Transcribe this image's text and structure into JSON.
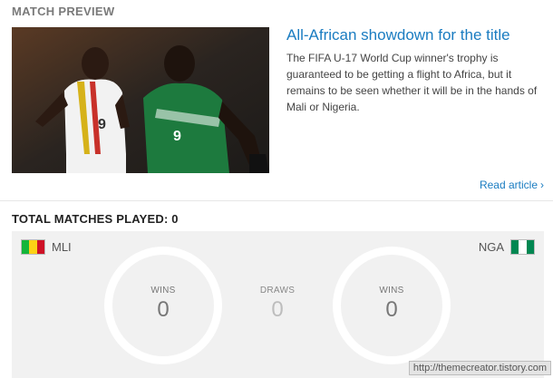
{
  "section": {
    "title": "MATCH PREVIEW"
  },
  "article": {
    "title": "All-African showdown for the title",
    "summary": "The FIFA U-17 World Cup winner's trophy is guaranteed to be getting a flight to Africa, but it remains to be seen whether it will be in the hands of Mali or Nigeria.",
    "read_more": "Read article",
    "read_more_icon": "chevron-right-icon",
    "photo_desc_icon": "match-photo"
  },
  "stats": {
    "total_label": "TOTAL MATCHES PLAYED: 0",
    "home": {
      "code": "MLI",
      "wins_label": "WINS",
      "wins": "0",
      "flag_colors": [
        "#14b53a",
        "#fcd116",
        "#ce1126"
      ]
    },
    "draws_label": "DRAWS",
    "draws": "0",
    "away": {
      "code": "NGA",
      "wins_label": "WINS",
      "wins": "0",
      "flag_colors": [
        "#008751",
        "#ffffff",
        "#008751"
      ]
    }
  },
  "watermark": "http://themecreator.tistory.com",
  "colors": {
    "link": "#1a7cc1",
    "panel": "#f1f1f1"
  }
}
